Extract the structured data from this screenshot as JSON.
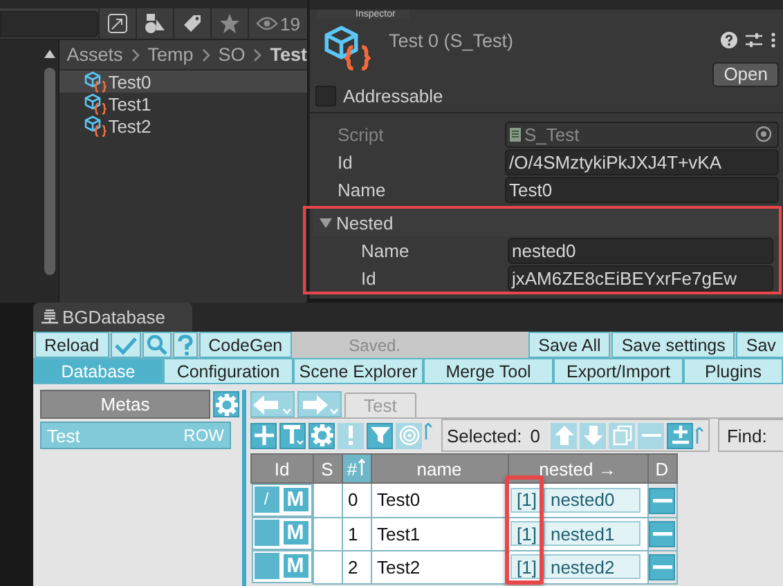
{
  "project": {
    "view_count": "19",
    "breadcrumb": [
      {
        "label": "Assets",
        "current": false
      },
      {
        "label": "Temp",
        "current": false
      },
      {
        "label": "SO",
        "current": false
      },
      {
        "label": "Test",
        "current": true
      }
    ],
    "assets": [
      {
        "name": "Test0",
        "selected": true
      },
      {
        "name": "Test1",
        "selected": false
      },
      {
        "name": "Test2",
        "selected": false
      }
    ]
  },
  "inspector": {
    "tab": "Inspector",
    "title": "Test 0 (S_Test)",
    "open_button": "Open",
    "addressable": {
      "label": "Addressable",
      "checked": false
    },
    "fields": [
      {
        "label": "Script",
        "value": "S_Test",
        "disabled": true
      },
      {
        "label": "Id",
        "value": "/O/4SMztykiPkJXJ4T+vKA",
        "disabled": false
      },
      {
        "label": "Name",
        "value": "Test0",
        "disabled": false
      }
    ],
    "nested": {
      "label": "Nested",
      "expanded": true,
      "highlighted": true,
      "fields": [
        {
          "label": "Name",
          "value": "nested0"
        },
        {
          "label": "Id",
          "value": "jxAM6ZE8cEiBEYxrFe7gEw"
        }
      ]
    }
  },
  "bgdatabase": {
    "title": "BGDatabase",
    "reload": "Reload",
    "codegen": "CodeGen",
    "status": "Saved.",
    "save_buttons": [
      "Save All",
      "Save settings",
      "Sav"
    ],
    "tabs": [
      {
        "label": "Database",
        "selected": true
      },
      {
        "label": "Configuration",
        "selected": false
      },
      {
        "label": "Scene Explorer",
        "selected": false
      },
      {
        "label": "Merge Tool",
        "selected": false
      },
      {
        "label": "Export/Import",
        "selected": false
      },
      {
        "label": "Plugins",
        "selected": false
      }
    ],
    "metas": {
      "header": "Metas",
      "items": [
        {
          "name": "Test",
          "tag": "ROW",
          "selected": true
        }
      ]
    },
    "meta_tab": "Test",
    "selected_label": "Selected:",
    "selected_count": "0",
    "find_label": "Find:",
    "table": {
      "columns": [
        {
          "label": "Id",
          "sorted": false
        },
        {
          "label": "S",
          "sorted": false
        },
        {
          "label": "#",
          "sorted": true
        },
        {
          "label": "name",
          "sorted": false
        },
        {
          "label": "nested →",
          "sorted": false,
          "highlighted": true
        },
        {
          "label": "D",
          "sorted": false
        }
      ],
      "rows": [
        {
          "id": "/",
          "meta": "M",
          "index": "0",
          "name": "Test0",
          "nested_count": "[1]",
          "nested_value": "nested0"
        },
        {
          "id": "",
          "meta": "M",
          "index": "1",
          "name": "Test1",
          "nested_count": "[1]",
          "nested_value": "nested1"
        },
        {
          "id": "",
          "meta": "M",
          "index": "2",
          "name": "Test2",
          "nested_count": "[1]",
          "nested_value": "nested2"
        }
      ]
    }
  }
}
